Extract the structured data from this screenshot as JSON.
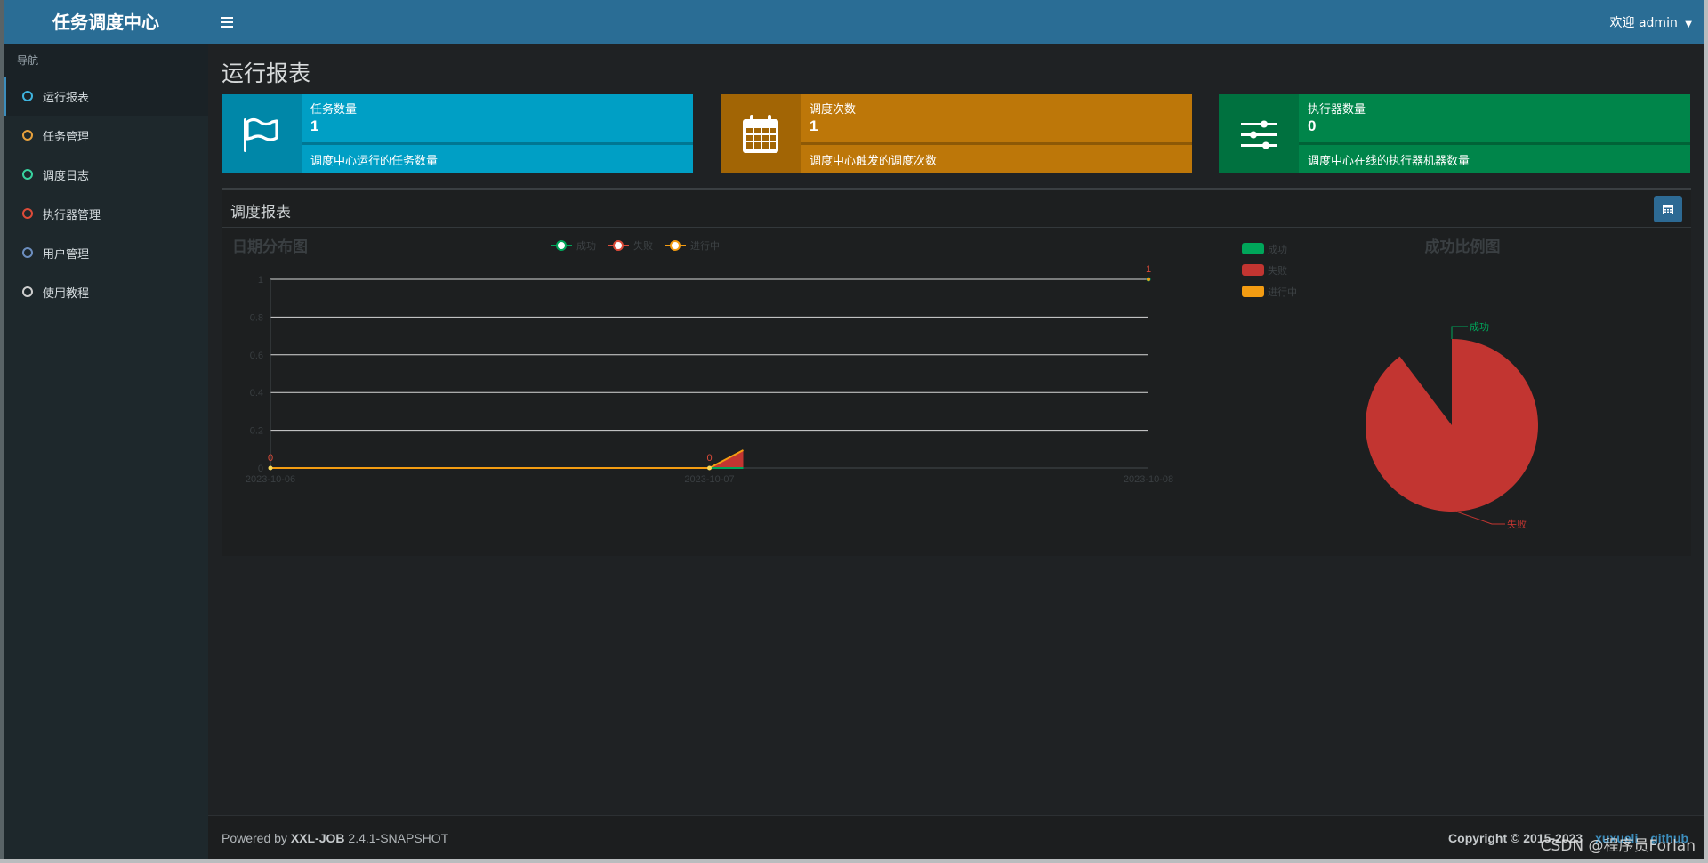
{
  "app": {
    "logo": "任务调度中心",
    "user_menu": "欢迎 admin"
  },
  "sidebar": {
    "header": "导航",
    "items": [
      {
        "label": "运行报表",
        "color": "#3fb5e0"
      },
      {
        "label": "任务管理",
        "color": "#e8a13c"
      },
      {
        "label": "调度日志",
        "color": "#38d39f"
      },
      {
        "label": "执行器管理",
        "color": "#dd4b39"
      },
      {
        "label": "用户管理",
        "color": "#6c8ebf"
      },
      {
        "label": "使用教程",
        "color": "#cfcfcf"
      }
    ]
  },
  "page": {
    "title": "运行报表"
  },
  "info_boxes": [
    {
      "label": "任务数量",
      "value": "1",
      "desc": "调度中心运行的任务数量",
      "icon": "flag-icon",
      "color": "#009fc5",
      "icon_bg": "#0087a8"
    },
    {
      "label": "调度次数",
      "value": "1",
      "desc": "调度中心触发的调度次数",
      "icon": "calendar-icon",
      "color": "#bd7709",
      "icon_bg": "#a26505"
    },
    {
      "label": "执行器数量",
      "value": "0",
      "desc": "调度中心在线的执行器机器数量",
      "icon": "sliders-icon",
      "color": "#00854a",
      "icon_bg": "#00713f"
    }
  ],
  "report": {
    "title": "调度报表"
  },
  "chart_data": [
    {
      "type": "line",
      "title": "日期分布图",
      "x": [
        "2023-10-06",
        "2023-10-07",
        "2023-10-08"
      ],
      "ylim": [
        0,
        1
      ],
      "yticks": [
        "0",
        "0.2",
        "0.4",
        "0.6",
        "0.8",
        "1"
      ],
      "series": [
        {
          "name": "成功",
          "color": "#00a65a",
          "values": [
            0,
            0,
            0
          ]
        },
        {
          "name": "失败",
          "color": "#dd4b39",
          "values": [
            0,
            0,
            1
          ]
        },
        {
          "name": "进行中",
          "color": "#f39c12",
          "values": [
            0,
            0,
            0
          ]
        }
      ],
      "data_labels": [
        "0",
        "0",
        "1"
      ],
      "legend": "top-center",
      "grid": true
    },
    {
      "type": "pie",
      "title": "成功比例图",
      "categories": [
        "成功",
        "失败",
        "进行中"
      ],
      "colors": [
        "#00a65a",
        "#c23531",
        "#f39c12"
      ],
      "values": [
        0,
        1,
        0
      ],
      "slice_labels": [
        "成功",
        "失败"
      ],
      "legend": "top-left"
    }
  ],
  "footer": {
    "powered_prefix": "Powered by ",
    "product": "XXL-JOB",
    "version": " 2.4.1-SNAPSHOT",
    "copyright": "Copyright © 2015-2023",
    "link1": "xuxueli",
    "link2": "github"
  },
  "watermark": "CSDN @程序员Forlan"
}
